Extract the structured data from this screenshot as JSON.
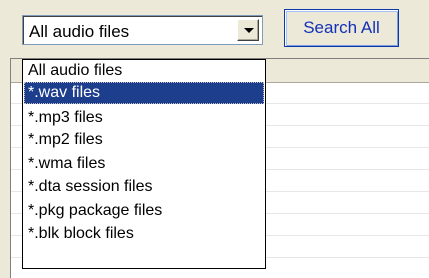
{
  "file_type_combo": {
    "value": "All audio files"
  },
  "search_all_label": "Search All",
  "dropdown": {
    "selected_index": 1,
    "options": [
      "All audio files",
      "*.wav files",
      "*.mp3 files",
      "*.mp2 files",
      "*.wma files",
      "*.dta session files",
      "*.pkg package files",
      "*.blk block files"
    ]
  },
  "colors": {
    "selection": "#1d3d8d",
    "search_text": "#1230b8"
  }
}
